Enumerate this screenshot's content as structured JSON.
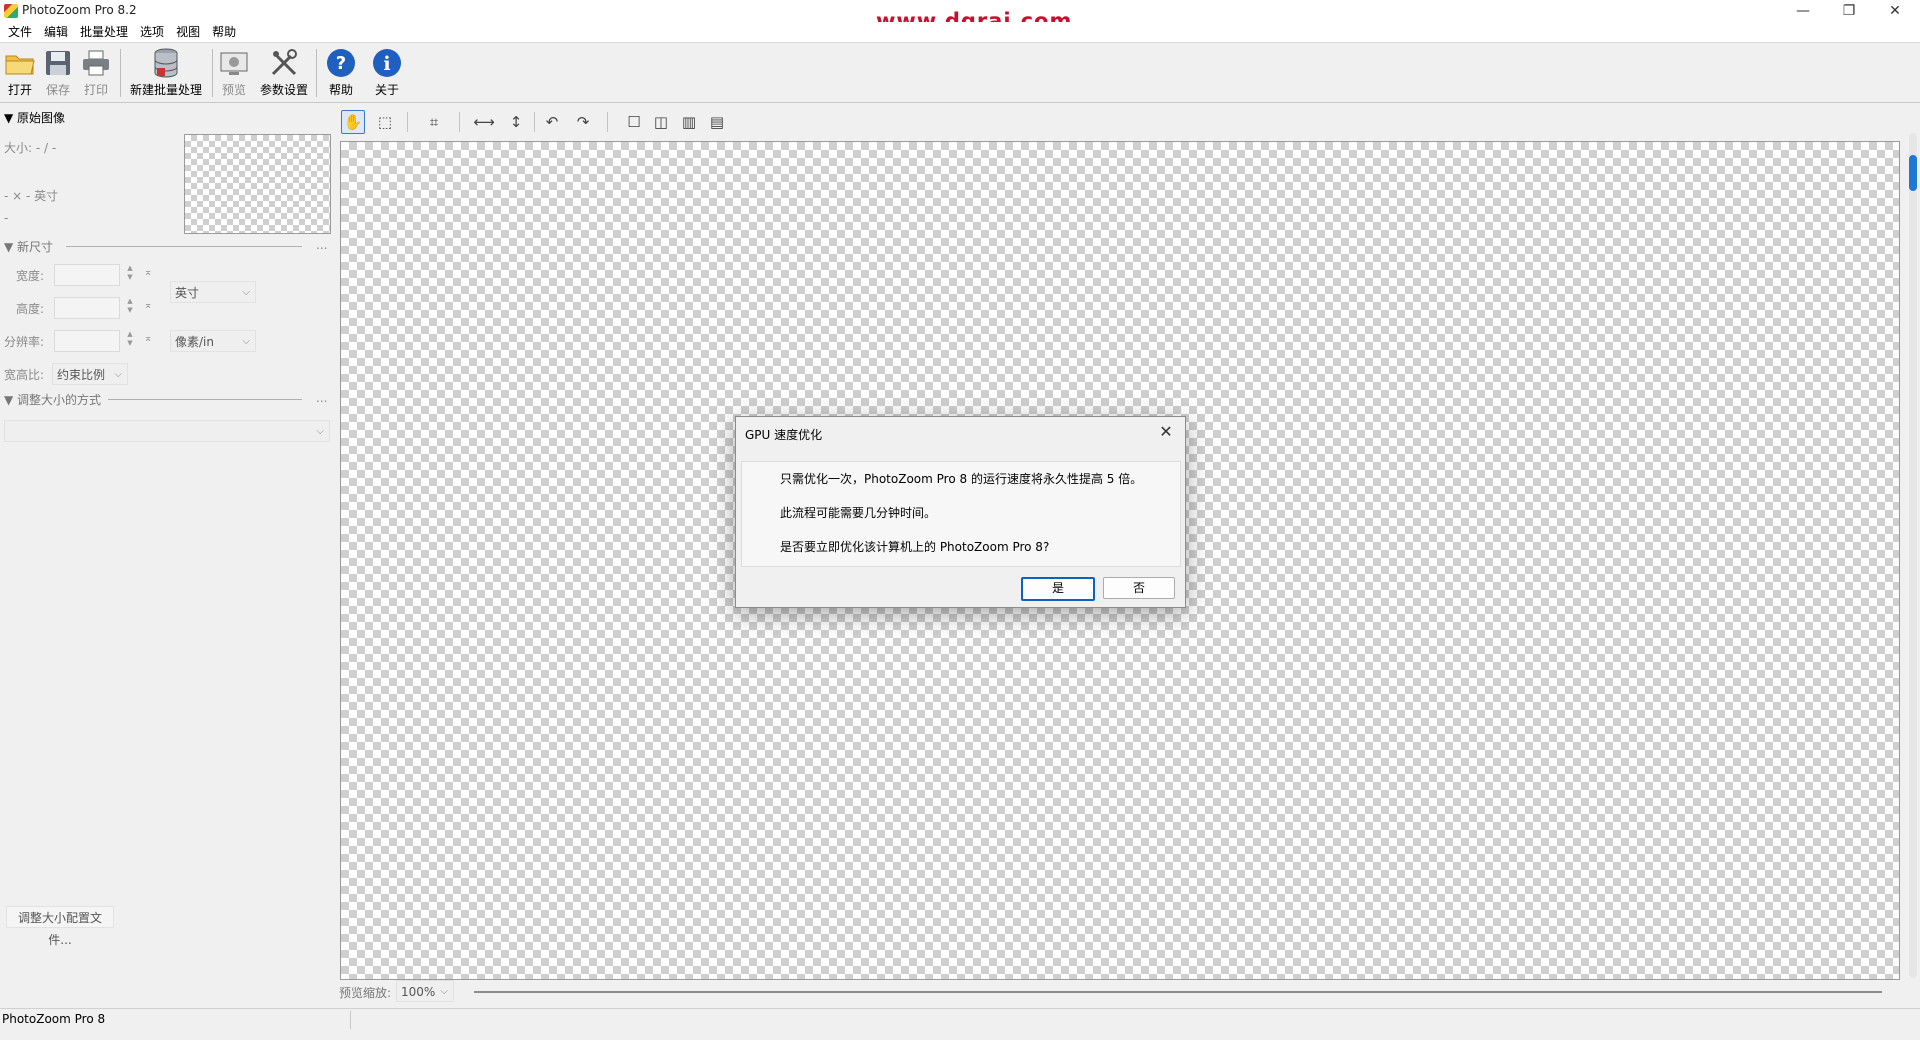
{
  "window": {
    "title": "PhotoZoom Pro 8.2",
    "watermark": "www.dgrai.com",
    "minimize": "—",
    "maximize": "❐",
    "close": "✕"
  },
  "menu": [
    "文件",
    "编辑",
    "批量处理",
    "选项",
    "视图",
    "帮助"
  ],
  "toolbar": {
    "open": "打开",
    "save": "保存",
    "print": "打印",
    "new_batch": "新建批量处理",
    "preview": "预览",
    "settings": "参数设置",
    "help": "帮助",
    "about": "关于"
  },
  "left_panel": {
    "original_image": "▼ 原始图像",
    "size_label": "大小: - / -",
    "dims_label": "- × - 英寸",
    "dash": "-",
    "new_size": "▼ 新尺寸",
    "width_label": "宽度:",
    "height_label": "高度:",
    "resolution_label": "分辨率:",
    "unit_select": "英寸",
    "res_unit_select": "像素/in",
    "aspect_label": "宽高比:",
    "aspect_select": "约束比例",
    "resize_method": "▼ 调整大小的方式",
    "more": "...",
    "profile_button": "调整大小配置文件..."
  },
  "preview": {
    "zoom_label": "预览缩放:",
    "zoom_value": "100%"
  },
  "dialog": {
    "title": "GPU 速度优化",
    "line1": "只需优化一次，PhotoZoom Pro 8 的运行速度将永久性提高 5 倍。",
    "line2": "此流程可能需要几分钟时间。",
    "line3": "是否要立即优化该计算机上的 PhotoZoom Pro 8?",
    "yes": "是",
    "no": "否"
  },
  "status": {
    "text": "PhotoZoom Pro 8"
  }
}
